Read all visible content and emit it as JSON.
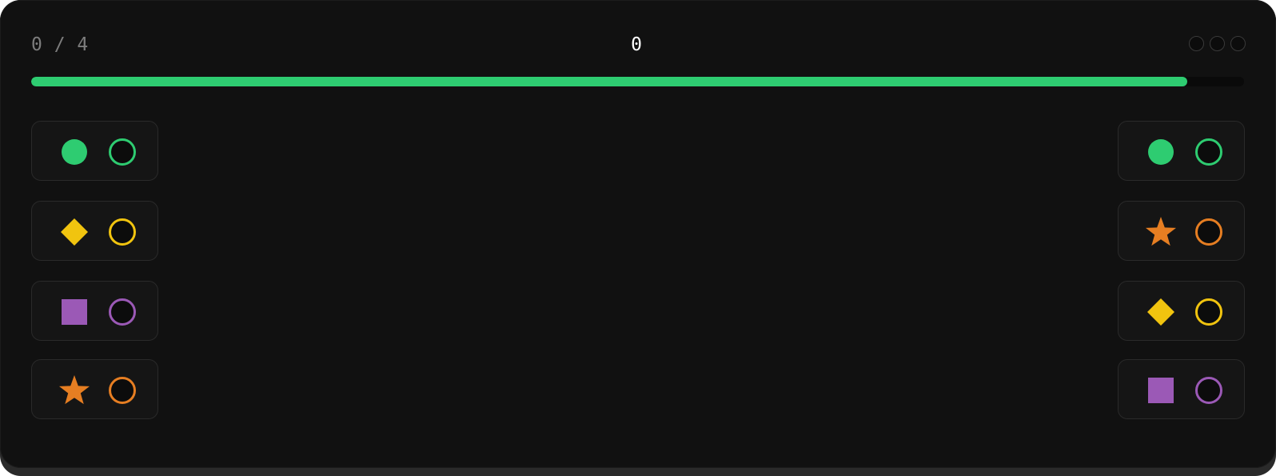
{
  "header": {
    "progress": "0 / 4",
    "score": "0",
    "lives_total": 3
  },
  "timer": {
    "remaining_fraction": 0.953,
    "color": "#2ecc71"
  },
  "colors": {
    "green": "#2ecc71",
    "yellow": "#f1c40f",
    "purple": "#9b59b6",
    "orange": "#e67e22"
  },
  "left_column": [
    {
      "shape": "circle",
      "color": "#2ecc71"
    },
    {
      "shape": "diamond",
      "color": "#f1c40f"
    },
    {
      "shape": "square",
      "color": "#9b59b6"
    },
    {
      "shape": "star",
      "color": "#e67e22"
    }
  ],
  "right_column": [
    {
      "shape": "circle",
      "color": "#2ecc71"
    },
    {
      "shape": "star",
      "color": "#e67e22"
    },
    {
      "shape": "diamond",
      "color": "#f1c40f"
    },
    {
      "shape": "square",
      "color": "#9b59b6"
    }
  ]
}
